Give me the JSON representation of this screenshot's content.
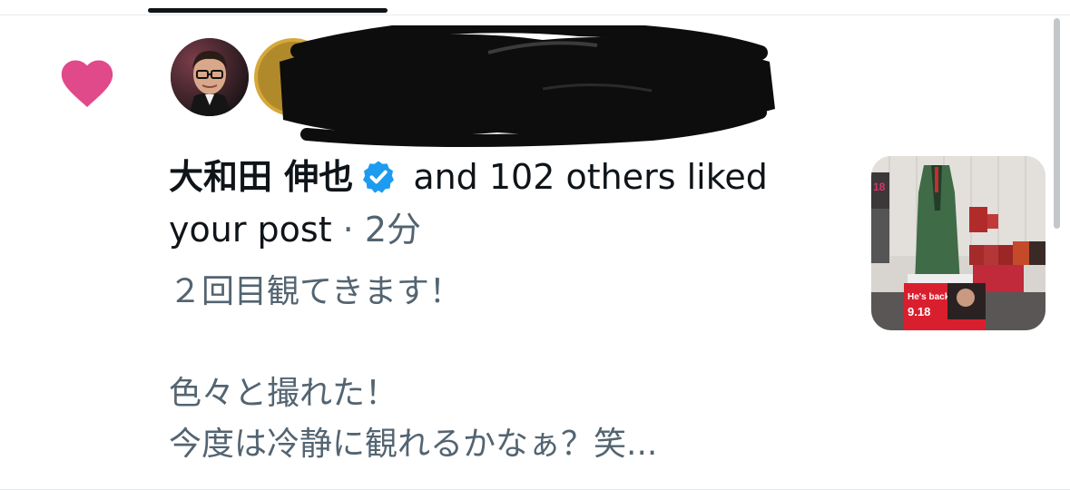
{
  "notification": {
    "user_name": "大和田 伸也",
    "verified_icon": "verified-badge-icon",
    "action_text": " and 102 others liked your post",
    "separator": " · ",
    "time_ago": "2分"
  },
  "post": {
    "text": "２回目観てきます！\n\n色々と撮れた！\n今度は冷静に観れるかなぁ？笑..."
  },
  "thumbnail": {
    "banner_text": "He's back.",
    "banner_date": "9.18",
    "side_text": "18"
  },
  "colors": {
    "like": "#e0498a",
    "verified": "#1d9bf0",
    "text_primary": "#0f1419",
    "text_secondary": "#536471"
  }
}
